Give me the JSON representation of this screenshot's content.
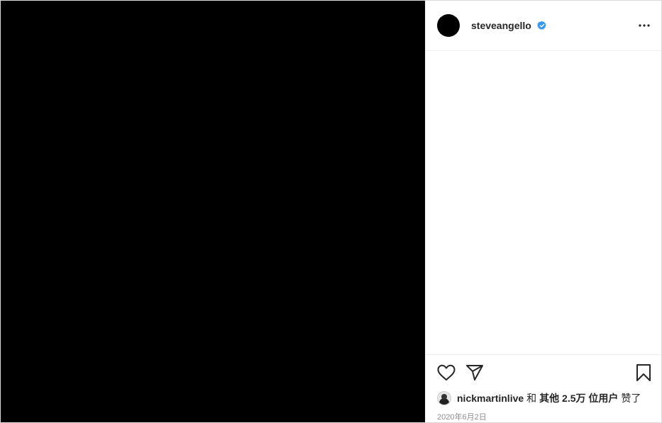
{
  "post": {
    "username": "steveangello",
    "verified_icon": "verified-badge-icon",
    "more_icon": "more-options-icon"
  },
  "actions": {
    "like_icon": "heart-icon",
    "share_icon": "paper-plane-icon",
    "save_icon": "bookmark-icon"
  },
  "likes": {
    "first_user": "nickmartinlive",
    "connector": "和",
    "others": "其他 2.5万 位用户",
    "suffix": "赞了"
  },
  "date": "2020年6月2日",
  "colors": {
    "media_bg": "#000000",
    "verified": "#3897f0",
    "text": "#262626",
    "secondary_text": "#8e8e8e",
    "border": "#efefef"
  }
}
